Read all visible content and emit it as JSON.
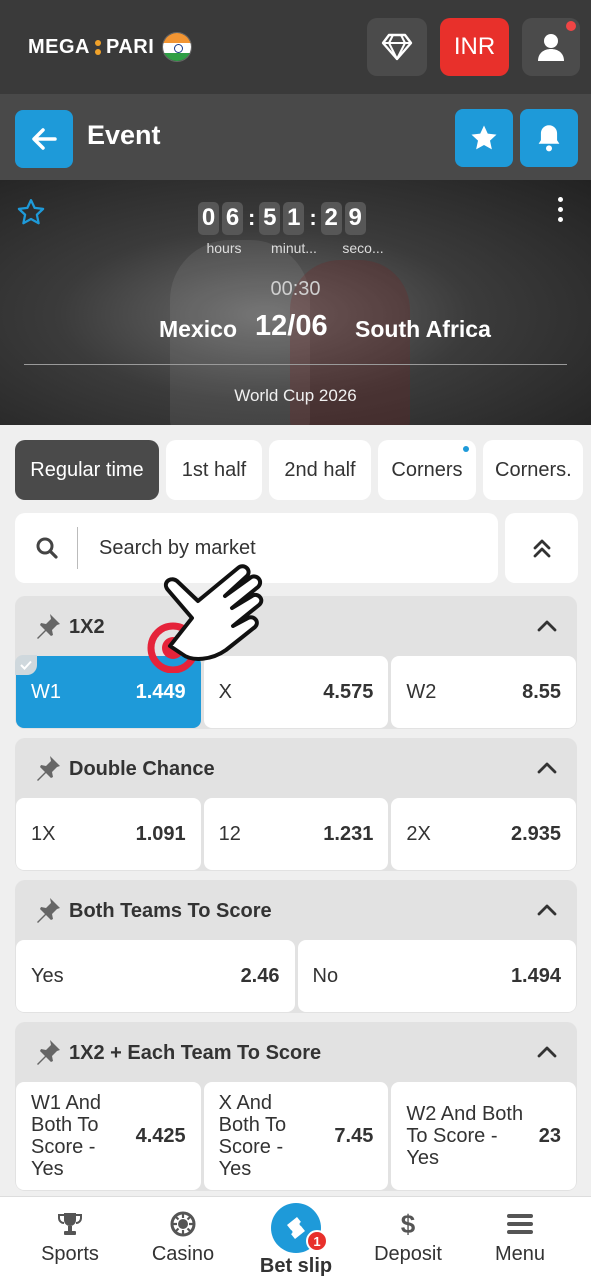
{
  "topbar": {
    "logo_left": "MEGA",
    "logo_right": "PARI",
    "currency": "INR"
  },
  "event_header": {
    "title": "Event"
  },
  "match": {
    "countdown": {
      "hours": [
        "0",
        "6"
      ],
      "minutes": [
        "5",
        "1"
      ],
      "seconds": [
        "2",
        "9"
      ]
    },
    "labels": {
      "hours": "hours",
      "minutes": "minut...",
      "seconds": "seco..."
    },
    "time": "00:30",
    "team1": "Mexico",
    "date": "12/06",
    "team2": "South Africa",
    "league": "World Cup 2026"
  },
  "tabs": [
    {
      "label": "Regular time",
      "active": true
    },
    {
      "label": "1st half"
    },
    {
      "label": "2nd half"
    },
    {
      "label": "Corners",
      "dot": true
    },
    {
      "label": "Corners."
    }
  ],
  "search": {
    "placeholder": "Search by market"
  },
  "markets": [
    {
      "title": "1X2",
      "odds": [
        {
          "label": "W1",
          "value": "1.449",
          "selected": true
        },
        {
          "label": "X",
          "value": "4.575"
        },
        {
          "label": "W2",
          "value": "8.55"
        }
      ]
    },
    {
      "title": "Double Chance",
      "odds": [
        {
          "label": "1X",
          "value": "1.091"
        },
        {
          "label": "12",
          "value": "1.231"
        },
        {
          "label": "2X",
          "value": "2.935"
        }
      ]
    },
    {
      "title": "Both Teams To Score",
      "odds": [
        {
          "label": "Yes",
          "value": "2.46"
        },
        {
          "label": "No",
          "value": "1.494"
        }
      ]
    },
    {
      "title": "1X2 + Each Team To Score",
      "odds": [
        {
          "label": "W1 And Both To Score - Yes",
          "value": "4.425"
        },
        {
          "label": "X And Both To Score - Yes",
          "value": "7.45"
        },
        {
          "label": "W2 And Both To Score - Yes",
          "value": "23"
        }
      ]
    }
  ],
  "bottom_nav": [
    {
      "label": "Sports",
      "icon": "trophy-icon"
    },
    {
      "label": "Casino",
      "icon": "casino-chip-icon"
    },
    {
      "label": "Bet slip",
      "icon": "ticket-icon",
      "badge": "1"
    },
    {
      "label": "Deposit",
      "icon": "dollar-icon"
    },
    {
      "label": "Menu",
      "icon": "hamburger-icon"
    }
  ],
  "colors": {
    "accent": "#1e9ad9",
    "topbar": "#3a3a3a",
    "red": "#e8302b"
  }
}
